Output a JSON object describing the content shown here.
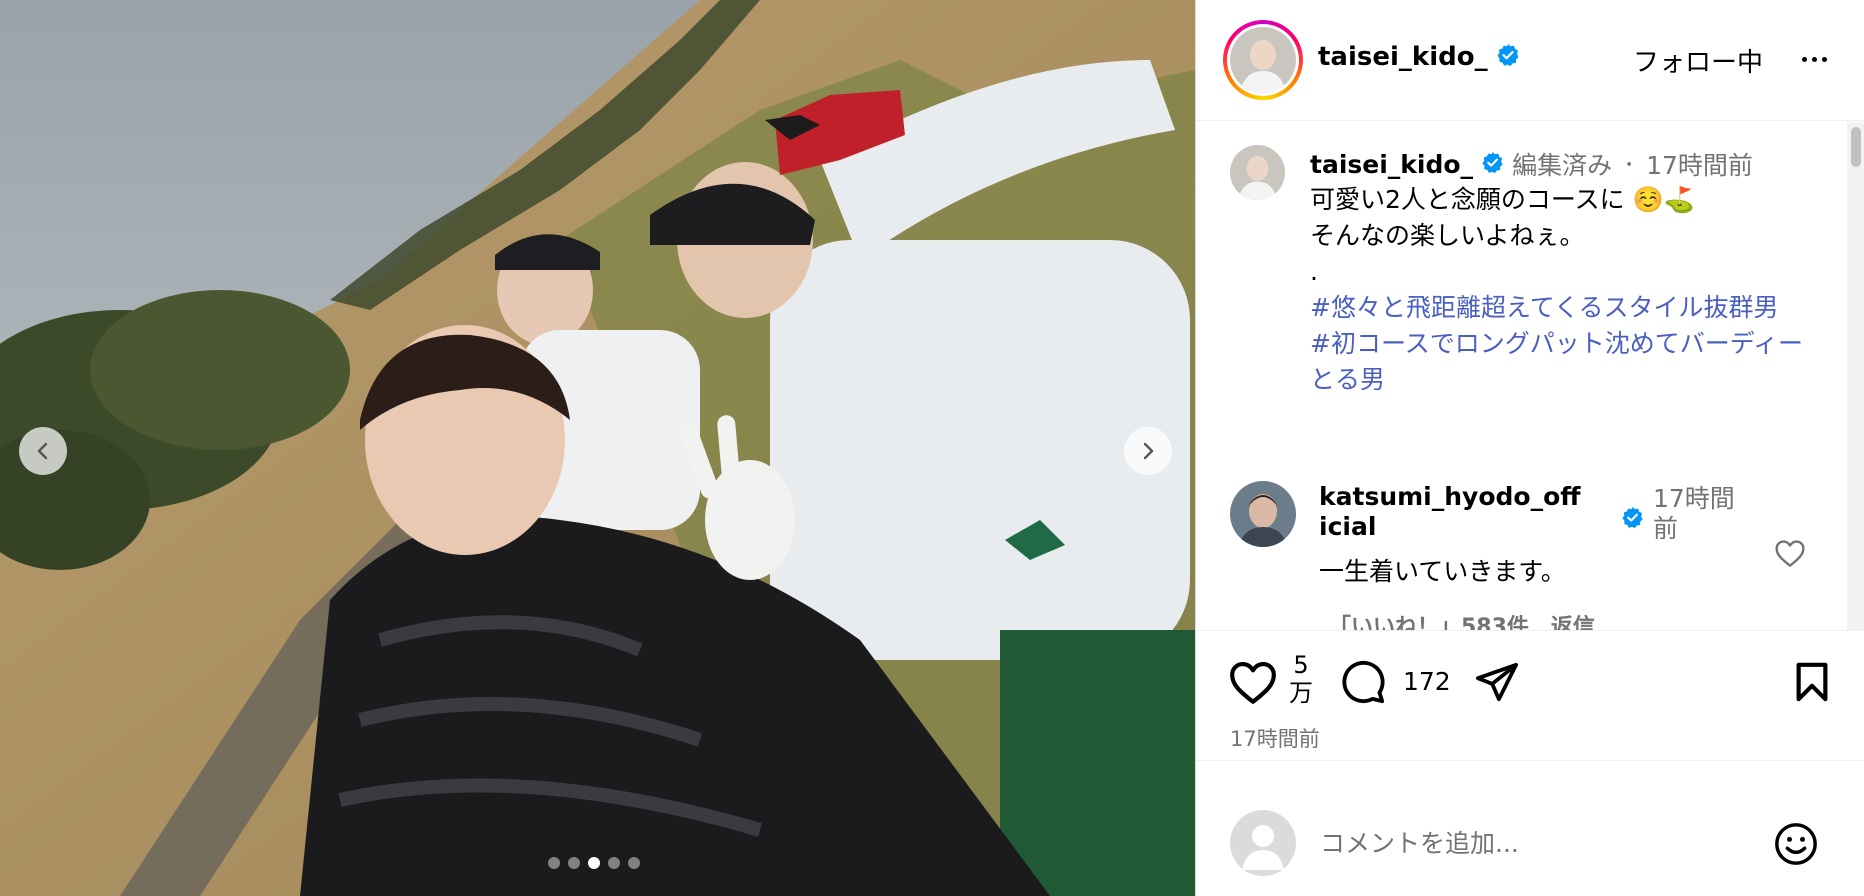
{
  "post": {
    "username": "taisei_kido_",
    "follow_status": "フォロー中",
    "caption": {
      "meta_edited": "編集済み",
      "meta_separator": "・",
      "meta_time": "17時間前",
      "line1": "可愛い2人と念願のコースに ☺️⛳",
      "line2": "そんなの楽しいよねぇ。",
      "line3": ".",
      "hashtag1": "#悠々と飛距離超えてくるスタイル抜群男",
      "hashtag2": "#初コースでロングパット沈めてバーディーとる男"
    },
    "comments": [
      {
        "username": "katsumi_hyodo_official",
        "time": "17時間前",
        "text": "一生着いていきます。",
        "meta": "「いいね！」583件　返信"
      }
    ],
    "likes_label": "5万",
    "comment_count": "172",
    "time": "17時間前"
  },
  "carousel": {
    "total": 5,
    "active_index": 2
  },
  "add_comment": {
    "placeholder": "コメントを追加..."
  },
  "colors": {
    "verified": "#0095f6",
    "hashtag": "#4a5fc1",
    "meta": "#737373"
  }
}
